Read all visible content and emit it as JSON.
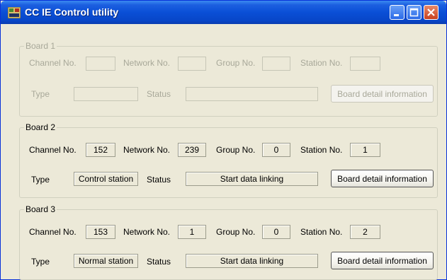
{
  "window": {
    "title": "CC IE Control utility",
    "accent_color": "#0a4fd6"
  },
  "labels": {
    "channel": "Channel No.",
    "network": "Network No.",
    "group": "Group No.",
    "station": "Station No.",
    "type": "Type",
    "status": "Status",
    "detail_button": "Board detail information"
  },
  "boards": [
    {
      "title": "Board 1",
      "enabled": false,
      "channel": "",
      "network": "",
      "group": "",
      "station": "",
      "type": "",
      "status": ""
    },
    {
      "title": "Board 2",
      "enabled": true,
      "channel": "152",
      "network": "239",
      "group": "0",
      "station": "1",
      "type": "Control station",
      "status": "Start data linking"
    },
    {
      "title": "Board 3",
      "enabled": true,
      "channel": "153",
      "network": "1",
      "group": "0",
      "station": "2",
      "type": "Normal station",
      "status": "Start data linking"
    }
  ]
}
